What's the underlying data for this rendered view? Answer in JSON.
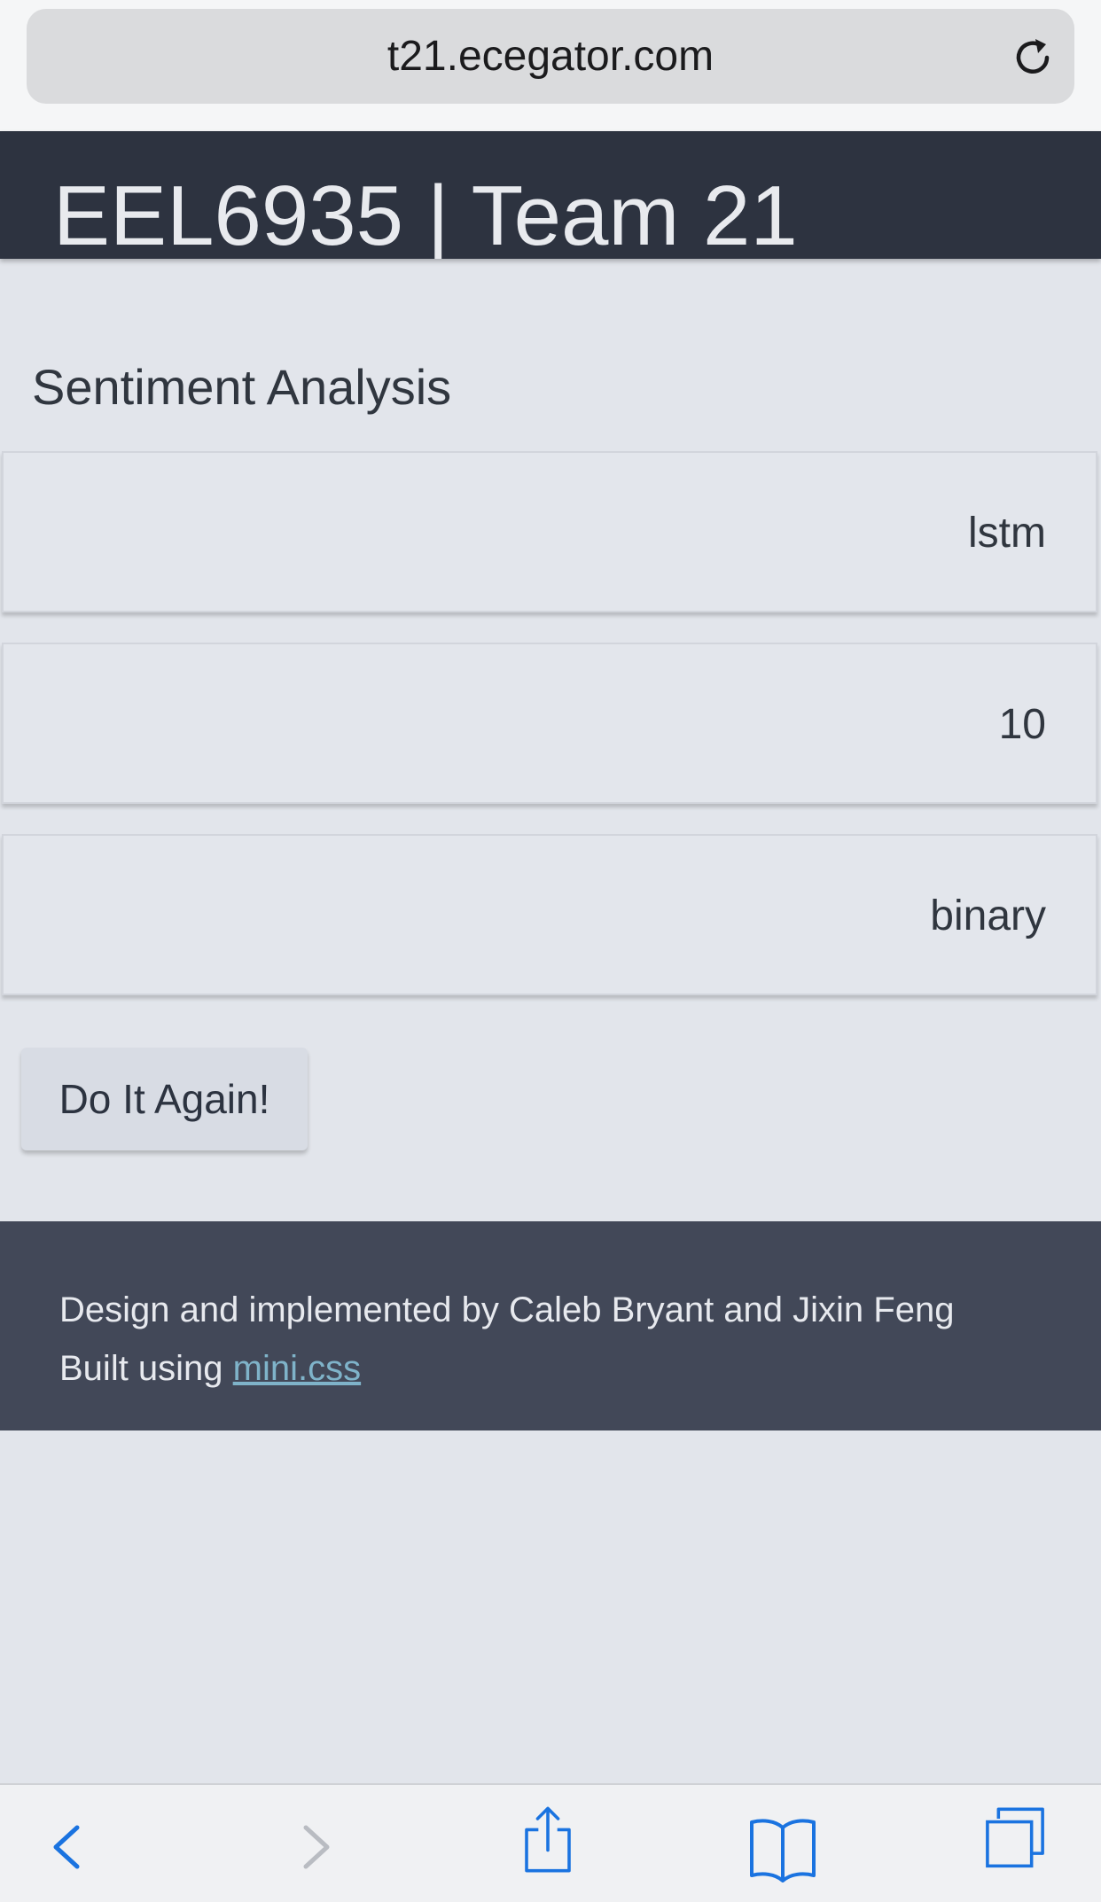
{
  "browser": {
    "url": "t21.ecegator.com",
    "reload_icon": "reload-icon"
  },
  "header": {
    "title": "EEL6935 | Team 21"
  },
  "main": {
    "heading": "Sentiment Analysis",
    "results": [
      {
        "value": "lstm"
      },
      {
        "value": "10"
      },
      {
        "value": "binary"
      }
    ],
    "again_button_label": "Do It Again!"
  },
  "footer": {
    "credits": "Design and implemented by Caleb Bryant and Jixin Feng",
    "built_prefix": "Built using ",
    "built_link": "mini.css"
  },
  "toolbar": {
    "icons": [
      "back-icon",
      "forward-icon",
      "share-icon",
      "bookmarks-icon",
      "tabs-icon"
    ]
  },
  "colors": {
    "page_bg": "#e2e5eb",
    "header_bg": "#2d3340",
    "footer_bg": "#424858",
    "link": "#7fb3c9",
    "toolbar_icon": "#1a73e0",
    "toolbar_icon_disabled": "#b9bcc2"
  }
}
